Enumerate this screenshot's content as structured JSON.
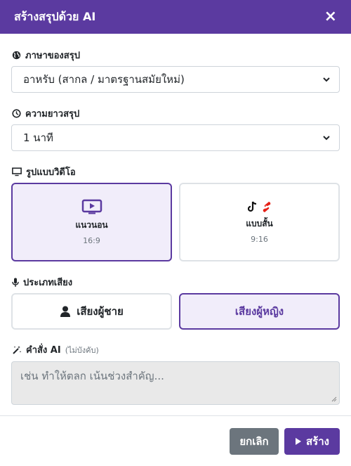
{
  "modal": {
    "title": "สร้างสรุปด้วย AI",
    "close": "×"
  },
  "language": {
    "label": "ภาษาของสรุป",
    "value": "อาหรับ (สากล / มาตรฐานสมัยใหม่)"
  },
  "length": {
    "label": "ความยาวสรุป",
    "value": "1 นาที"
  },
  "format": {
    "label": "รูปแบบวิดีโอ",
    "options": [
      {
        "title": "แนวนอน",
        "ratio": "16:9",
        "selected": true,
        "icon": "play-icon"
      },
      {
        "title": "แบบสั้น",
        "ratio": "9:16",
        "selected": false,
        "icon": "tiktok-youtube-shorts-icon"
      }
    ]
  },
  "voice": {
    "label": "ประเภทเสียง",
    "options": [
      {
        "label": "เสียงผู้ชาย",
        "selected": false,
        "icon": "user-icon"
      },
      {
        "label": "เสียงผู้หญิง",
        "selected": true,
        "icon": ""
      }
    ]
  },
  "prompt": {
    "label": "คำสั่ง AI",
    "optional": "(ไม่บังคับ)",
    "placeholder": "เช่น ทำให้ตลก เน้นช่วงสำคัญ..."
  },
  "footer": {
    "cancel": "ยกเลิก",
    "create": "สร้าง"
  },
  "colors": {
    "accent": "#5b3aa0",
    "selected_bg": "#f1edfa",
    "cancel": "#6c757d"
  }
}
